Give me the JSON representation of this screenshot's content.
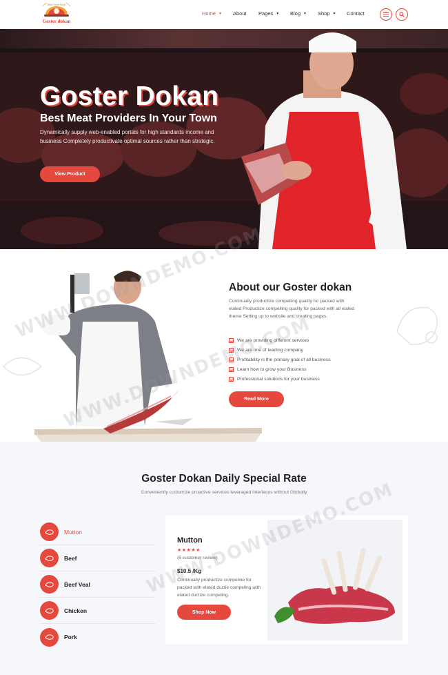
{
  "header": {
    "logo": {
      "top_text": "Best Fresh Meat",
      "brand": "Goster dokan"
    },
    "nav": [
      {
        "label": "Home",
        "dropdown": true,
        "active": true
      },
      {
        "label": "About",
        "dropdown": false,
        "active": false
      },
      {
        "label": "Pages",
        "dropdown": true,
        "active": false
      },
      {
        "label": "Blog",
        "dropdown": true,
        "active": false
      },
      {
        "label": "Shop",
        "dropdown": true,
        "active": false
      },
      {
        "label": "Contact",
        "dropdown": false,
        "active": false
      }
    ],
    "icons": [
      "menu-icon",
      "search-icon"
    ]
  },
  "hero": {
    "title": "Goster Dokan",
    "subtitle": "Best Meat Providers In Your Town",
    "description": "Dynamically supply web-enabled portals for high standards income and business Completely productivate optimal sources rather than strategic.",
    "button": "View Product"
  },
  "about": {
    "title": "About our Goster dokan",
    "description": "Continually productize compelling quality for packed with elated Productize compelling quality for packed with all elated theme Setting up to website and creating pages.",
    "list": [
      "We are providing different services",
      "We are one of leading company",
      "Profitability is the primary goal of all business",
      "Learn how to grow your Business",
      "Professional solutions for your business"
    ],
    "button": "Read More"
  },
  "rate": {
    "title": "Goster Dokan Daily Special Rate",
    "subtitle": "Conveniently customize proactive services leveraged interfaces without Globally",
    "categories": [
      {
        "label": "Mutton",
        "active": true
      },
      {
        "label": "Beef",
        "active": false
      },
      {
        "label": "Beef Veal",
        "active": false
      },
      {
        "label": "Chicken",
        "active": false
      },
      {
        "label": "Pork",
        "active": false
      }
    ],
    "product": {
      "name": "Mutton",
      "rating": 5,
      "stars": "★★★★★",
      "reviews": "(5 customer review)",
      "price": "$10.5 /Kg",
      "description": "Continually productize compeline for packed with elated ductie compeling with elated ductize compeling.",
      "button": "Shop Now"
    }
  },
  "watermark": "WWW.DOWNDEMO.COM",
  "colors": {
    "accent": "#e5483d",
    "rate_bg": "#f6f7fb",
    "hero_bg": "#4a2626"
  }
}
